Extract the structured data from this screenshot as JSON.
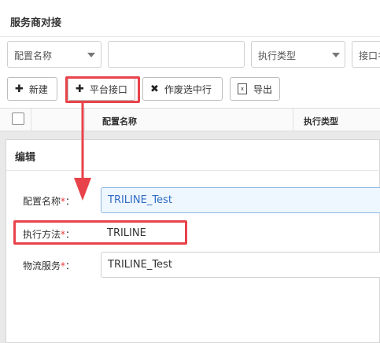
{
  "page": {
    "title": "服务商对接"
  },
  "filters": {
    "config_name": "配置名称",
    "text_value": "",
    "exec_type": "执行类型",
    "interface": "接口名"
  },
  "toolbar": {
    "new_label": "新建",
    "platform_label": "平台接口",
    "void_label": "作废选中行",
    "export_label": "导出"
  },
  "table": {
    "columns": [
      "配置名称",
      "执行类型"
    ]
  },
  "modal": {
    "title": "编辑",
    "fields": [
      {
        "label": "配置名称",
        "required_mark": "*",
        "colon": "：",
        "value": "TRILINE_Test"
      },
      {
        "label": "执行方法",
        "required_mark": "*",
        "colon": "：",
        "value": "TRILINE"
      },
      {
        "label": "物流服务",
        "required_mark": "*",
        "colon": "：",
        "value": "TRILINE_Test"
      }
    ]
  },
  "annotation": {
    "color": "#e8424a"
  }
}
